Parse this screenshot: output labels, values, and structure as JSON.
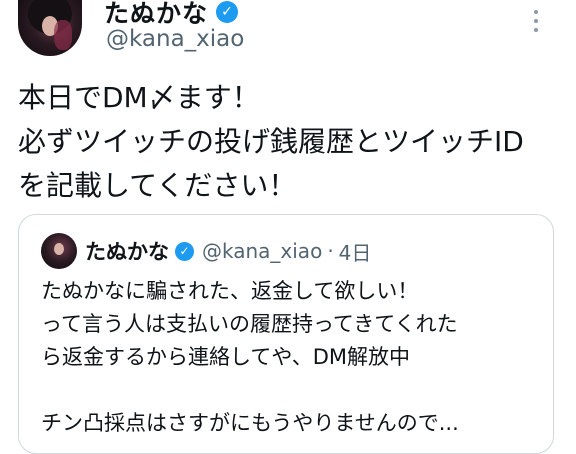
{
  "tweet": {
    "display_name": "たぬかな",
    "verified_icon": "✓",
    "handle": "@kana_xiao",
    "lines": [
      "本日でDM〆ます！",
      "必ずツイッチの投げ銭履歴とツイッチID",
      "を記載してください！"
    ]
  },
  "quote": {
    "display_name": "たぬかな",
    "verified_icon": "✓",
    "handle": "@kana_xiao",
    "separator": "·",
    "time": "4日",
    "lines": [
      "たぬかなに騙された、返金して欲しい！",
      "って言う人は支払いの履歴持ってきてくれた",
      "ら返金するから連絡してや、DM解放中",
      "",
      "チン凸採点はさすがにもうやりませんので..."
    ]
  },
  "colors": {
    "verified": "#1d9bf0",
    "secondary_text": "#536471",
    "border": "#cfd9de"
  },
  "icons": {
    "verified": "verified-badge-icon",
    "more": "more-options-icon"
  }
}
